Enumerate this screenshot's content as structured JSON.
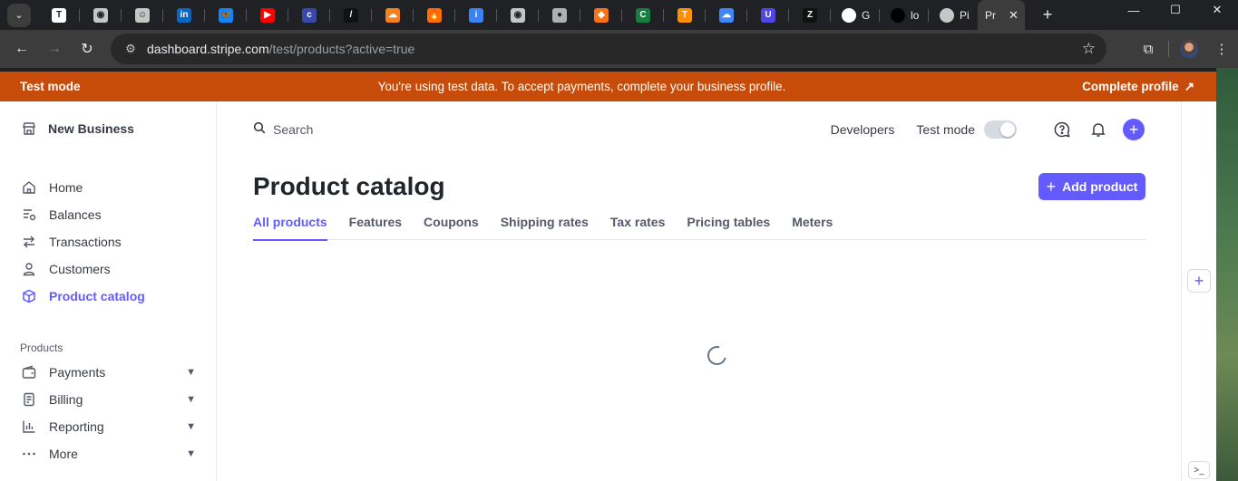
{
  "browser": {
    "tabs": [
      {
        "icon": "dictionary-icon",
        "color": "#ffffff",
        "glyph": "T"
      },
      {
        "icon": "globe-icon",
        "color": "#c4c7c5",
        "glyph": "◉"
      },
      {
        "icon": "copilot-icon",
        "color": "#c4c7c5",
        "glyph": "☺"
      },
      {
        "icon": "linkedin-icon",
        "color": "#0a66c2",
        "glyph": "in"
      },
      {
        "icon": "bluesky-icon",
        "color": "#1185fe",
        "glyph": "🦋"
      },
      {
        "icon": "youtube-icon",
        "color": "#ff0000",
        "glyph": "▶"
      },
      {
        "icon": "c-logo-icon",
        "color": "#3949ab",
        "glyph": "c"
      },
      {
        "icon": "slash-icon",
        "color": "#111111",
        "glyph": "/"
      },
      {
        "icon": "cloudflare-icon",
        "color": "#f38020",
        "glyph": "☁"
      },
      {
        "icon": "firebase-icon",
        "color": "#ff6d00",
        "glyph": "🔥"
      },
      {
        "icon": "info-icon",
        "color": "#3b82f6",
        "glyph": "i"
      },
      {
        "icon": "globe-icon",
        "color": "#c4c7c5",
        "glyph": "◉"
      },
      {
        "icon": "cookie-icon",
        "color": "#b0b0b0",
        "glyph": "●"
      },
      {
        "icon": "box-icon",
        "color": "#f97316",
        "glyph": "◆"
      },
      {
        "icon": "codacy-icon",
        "color": "#15803d",
        "glyph": "C"
      },
      {
        "icon": "tensorflow-icon",
        "color": "#ff8f00",
        "glyph": "T"
      },
      {
        "icon": "google-cloud-icon",
        "color": "#4285f4",
        "glyph": "☁"
      },
      {
        "icon": "w-logo-icon",
        "color": "#4f46e5",
        "glyph": "U"
      },
      {
        "icon": "zendesk-icon",
        "color": "#111111",
        "glyph": "Z"
      }
    ],
    "text_tabs": [
      {
        "icon": "google-icon",
        "label": "G"
      },
      {
        "icon": "vercel-icon",
        "label": "lo"
      },
      {
        "icon": "globe-icon",
        "label": "Pi"
      }
    ],
    "active_tab": {
      "label": "Pr",
      "close": "✕"
    },
    "new_tab": "+",
    "url_host": "dashboard.stripe.com",
    "url_path": "/test/products?active=true"
  },
  "banner": {
    "mode_label": "Test mode",
    "message": "You're using test data. To accept payments, complete your business profile.",
    "cta": "Complete profile",
    "cta_arrow": "↗"
  },
  "sidebar": {
    "business_name": "New Business",
    "items": [
      {
        "label": "Home"
      },
      {
        "label": "Balances"
      },
      {
        "label": "Transactions"
      },
      {
        "label": "Customers"
      },
      {
        "label": "Product catalog"
      }
    ],
    "section_label": "Products",
    "product_items": [
      {
        "label": "Payments"
      },
      {
        "label": "Billing"
      },
      {
        "label": "Reporting"
      },
      {
        "label": "More"
      }
    ]
  },
  "topbar": {
    "search_placeholder": "Search",
    "developers": "Developers",
    "test_mode": "Test mode"
  },
  "main": {
    "title": "Product catalog",
    "add_button": "Add product",
    "tabs": [
      {
        "label": "All products"
      },
      {
        "label": "Features"
      },
      {
        "label": "Coupons"
      },
      {
        "label": "Shipping rates"
      },
      {
        "label": "Tax rates"
      },
      {
        "label": "Pricing tables"
      },
      {
        "label": "Meters"
      }
    ]
  },
  "colors": {
    "accent": "#635bff",
    "banner": "#c84c09",
    "text": "#353a44"
  }
}
